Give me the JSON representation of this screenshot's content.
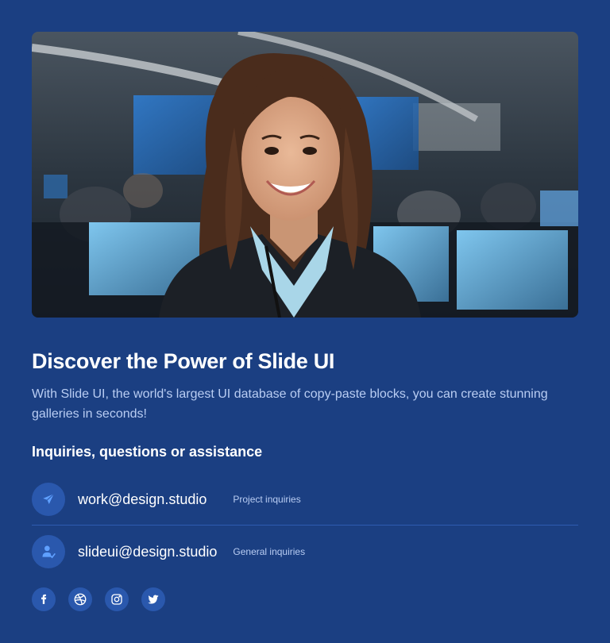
{
  "hero": {
    "image_alt": "Smiling woman in business suit in an office with monitors"
  },
  "content": {
    "title": "Discover the Power of Slide UI",
    "description": "With Slide UI, the world's largest UI database of copy-paste blocks, you can create stunning galleries in seconds!",
    "subheading": "Inquiries, questions or assistance"
  },
  "contacts": [
    {
      "email": "work@design.studio",
      "label": "Project inquiries",
      "icon": "send-icon"
    },
    {
      "email": "slideui@design.studio",
      "label": "General inquiries",
      "icon": "user-check-icon"
    }
  ],
  "socials": [
    {
      "name": "facebook",
      "icon": "facebook-icon"
    },
    {
      "name": "dribbble",
      "icon": "dribbble-icon"
    },
    {
      "name": "instagram",
      "icon": "instagram-icon"
    },
    {
      "name": "twitter",
      "icon": "twitter-icon"
    }
  ],
  "colors": {
    "background": "#1b3f82",
    "icon_circle": "#2a58ad",
    "accent_icon": "#5fa0ff",
    "muted_text": "#b9cdf3"
  }
}
